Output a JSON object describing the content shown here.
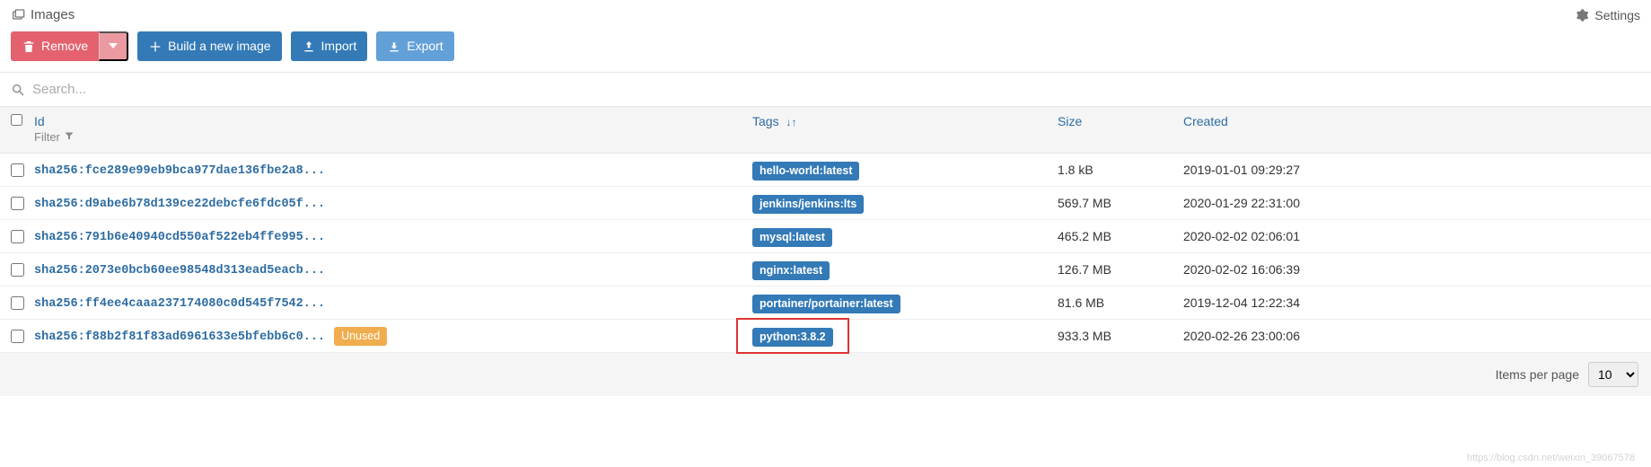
{
  "header": {
    "title": "Images",
    "settings_label": "Settings"
  },
  "toolbar": {
    "remove_label": "Remove",
    "build_label": "Build a new image",
    "import_label": "Import",
    "export_label": "Export"
  },
  "search": {
    "placeholder": "Search..."
  },
  "columns": {
    "id": "Id",
    "filter": "Filter",
    "tags": "Tags",
    "size": "Size",
    "created": "Created"
  },
  "rows": [
    {
      "id": "sha256:fce289e99eb9bca977dae136fbe2a8...",
      "tag": "hello-world:latest",
      "size": "1.8 kB",
      "created": "2019-01-01 09:29:27",
      "unused": false,
      "highlight": false
    },
    {
      "id": "sha256:d9abe6b78d139ce22debcfe6fdc05f...",
      "tag": "jenkins/jenkins:lts",
      "size": "569.7 MB",
      "created": "2020-01-29 22:31:00",
      "unused": false,
      "highlight": false
    },
    {
      "id": "sha256:791b6e40940cd550af522eb4ffe995...",
      "tag": "mysql:latest",
      "size": "465.2 MB",
      "created": "2020-02-02 02:06:01",
      "unused": false,
      "highlight": false
    },
    {
      "id": "sha256:2073e0bcb60ee98548d313ead5eacb...",
      "tag": "nginx:latest",
      "size": "126.7 MB",
      "created": "2020-02-02 16:06:39",
      "unused": false,
      "highlight": false
    },
    {
      "id": "sha256:ff4ee4caaa237174080c0d545f7542...",
      "tag": "portainer/portainer:latest",
      "size": "81.6 MB",
      "created": "2019-12-04 12:22:34",
      "unused": false,
      "highlight": false
    },
    {
      "id": "sha256:f88b2f81f83ad6961633e5bfebb6c0...",
      "tag": "python:3.8.2",
      "size": "933.3 MB",
      "created": "2020-02-26 23:00:06",
      "unused": true,
      "highlight": true
    }
  ],
  "badges": {
    "unused": "Unused"
  },
  "footer": {
    "items_per_page_label": "Items per page",
    "items_per_page_value": "10"
  },
  "watermark": "https://blog.csdn.net/weixin_39067578"
}
